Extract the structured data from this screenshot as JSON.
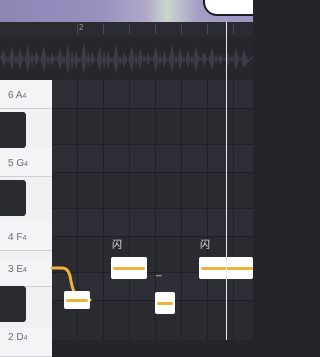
{
  "timeline": {
    "bar_number": "2"
  },
  "piano_keys": [
    {
      "octave_label": "6 A",
      "sub": "4"
    },
    {
      "octave_label": "5 G",
      "sub": "4"
    },
    {
      "octave_label": "4 F",
      "sub": "4"
    },
    {
      "octave_label": "3 E",
      "sub": "4"
    },
    {
      "octave_label": "2 D",
      "sub": "4"
    }
  ],
  "notes": [
    {
      "lyric": ""
    },
    {
      "lyric": "闪"
    },
    {
      "lyric": "_"
    },
    {
      "lyric": "闪"
    }
  ],
  "colors": {
    "pitch_line": "#f1b13a",
    "note_block": "#ffffff",
    "background": "#24252b"
  }
}
